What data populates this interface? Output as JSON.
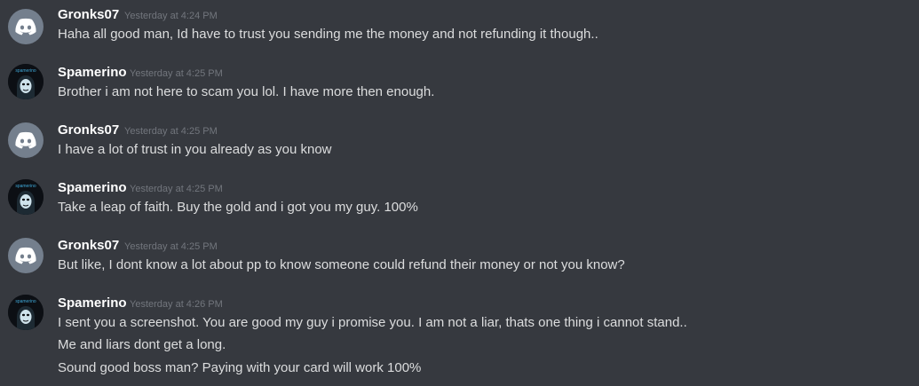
{
  "messages": [
    {
      "avatar": "discord-default-icon",
      "author": "Gronks07",
      "timestamp": "Yesterday at 4:24 PM",
      "lines": [
        "Haha all good man, Id have to trust you sending me the money and not refunding it though.."
      ]
    },
    {
      "avatar": "hacker-avatar-icon",
      "author": "Spamerino",
      "timestamp": "Yesterday at 4:25 PM",
      "lines": [
        "Brother i am not here to scam you lol. I have more then enough."
      ]
    },
    {
      "avatar": "discord-default-icon",
      "author": "Gronks07",
      "timestamp": "Yesterday at 4:25 PM",
      "lines": [
        "I have a lot of trust in you already as you know"
      ]
    },
    {
      "avatar": "hacker-avatar-icon",
      "author": "Spamerino",
      "timestamp": "Yesterday at 4:25 PM",
      "lines": [
        "Take a leap of faith. Buy the gold and i got you my guy. 100%"
      ]
    },
    {
      "avatar": "discord-default-icon",
      "author": "Gronks07",
      "timestamp": "Yesterday at 4:25 PM",
      "lines": [
        "But like, I dont know a lot about pp to know someone could refund their money or not you know?"
      ]
    },
    {
      "avatar": "hacker-avatar-icon",
      "author": "Spamerino",
      "timestamp": "Yesterday at 4:26 PM",
      "lines": [
        "I sent you a screenshot. You are good my guy i promise you. I am not a liar, thats one thing i cannot stand..",
        "Me and liars dont get a long.",
        "Sound good boss man? Paying with your card will work 100%"
      ]
    }
  ],
  "colors": {
    "background": "#36393f",
    "username": "#ffffff",
    "timestamp": "#72767d",
    "text": "#dcddde",
    "default_avatar": "#747f8d"
  }
}
